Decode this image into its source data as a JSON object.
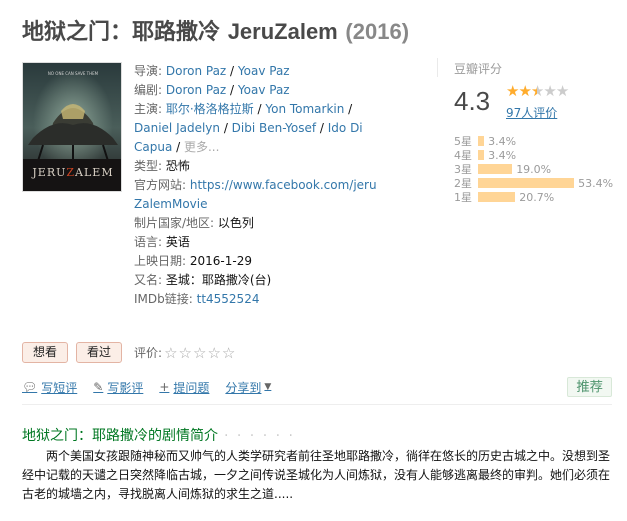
{
  "title": {
    "cn": "地狱之门：耶路撒冷",
    "latin": "JeruZalem",
    "year": "(2016)"
  },
  "poster": {
    "text_top": "NO ONE CAN SAVE THEM",
    "title": "JERUZALEM"
  },
  "info": {
    "director_label": "导演: ",
    "directors": [
      "Doron Paz",
      "Yoav Paz"
    ],
    "writer_label": "编剧: ",
    "writers": [
      "Doron Paz",
      "Yoav Paz"
    ],
    "cast_label": "主演: ",
    "cast": [
      "耶尔·格洛格拉斯",
      "Yon Tomarkin",
      "Daniel Jadelyn",
      "Dibi Ben-Yosef",
      "Ido Di Capua"
    ],
    "cast_more": "更多...",
    "genre_label": "类型: ",
    "genre": "恐怖",
    "website_label": "官方网站: ",
    "website": "https://www.facebook.com/jeruZalemMovie",
    "country_label": "制片国家/地区: ",
    "country": "以色列",
    "language_label": "语言: ",
    "language": "英语",
    "release_label": "上映日期: ",
    "release": "2016-1-29",
    "aka_label": "又名: ",
    "aka": "圣城：耶路撒冷(台)",
    "imdb_label": "IMDb链接: ",
    "imdb": "tt4552524"
  },
  "rating": {
    "title": "豆瓣评分",
    "score": "4.3",
    "votes": "97人评价",
    "stars_filled": 2.5,
    "distribution": [
      {
        "label": "5星",
        "pct": "3.4%",
        "value": 3.4
      },
      {
        "label": "4星",
        "pct": "3.4%",
        "value": 3.4
      },
      {
        "label": "3星",
        "pct": "19.0%",
        "value": 19.0
      },
      {
        "label": "2星",
        "pct": "53.4%",
        "value": 53.4
      },
      {
        "label": "1星",
        "pct": "20.7%",
        "value": 20.7
      }
    ]
  },
  "buttons": {
    "want": "想看",
    "seen": "看过",
    "rate_label": "评价:"
  },
  "actions": {
    "short_review": "写短评",
    "review": "写影评",
    "ask": "提问题",
    "share": "分享到",
    "recommend": "推荐"
  },
  "synopsis": {
    "title": "地狱之门：耶路撒冷的剧情简介",
    "dots": "· · · · · ·",
    "text": "两个美国女孩跟随神秘而又帅气的人类学研究者前往圣地耶路撒冷，徜徉在悠长的历史古城之中。没想到圣经中记载的天谴之日突然降临古城，一夕之间传说圣城化为人间炼狱，没有人能够逃离最终的审判。她们必须在古老的城墙之内，寻找脱离人间炼狱的求生之道....."
  }
}
